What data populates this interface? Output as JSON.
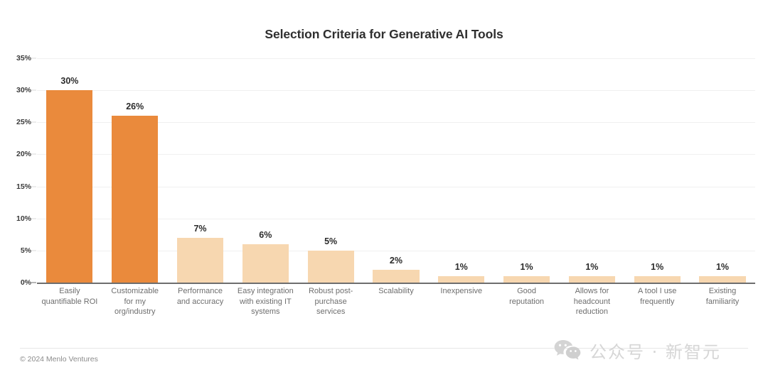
{
  "chart_data": {
    "type": "bar",
    "title": "Selection Criteria for Generative AI Tools",
    "xlabel": "",
    "ylabel": "",
    "ylim": [
      0,
      35
    ],
    "grid": true,
    "legend": "none",
    "y_ticks": [
      "0%",
      "5%",
      "10%",
      "15%",
      "20%",
      "25%",
      "30%",
      "35%"
    ],
    "y_tick_values": [
      0,
      5,
      10,
      15,
      20,
      25,
      30,
      35
    ],
    "categories": [
      "Easily\nquantifiable ROI",
      "Customizable\nfor my\norg/industry",
      "Performance\nand accuracy",
      "Easy integration\nwith existing IT\nsystems",
      "Robust post-\npurchase\nservices",
      "Scalability",
      "Inexpensive",
      "Good\nreputation",
      "Allows for\nheadcount\nreduction",
      "A tool I use\nfrequently",
      "Existing\nfamiliarity"
    ],
    "values": [
      30,
      26,
      7,
      6,
      5,
      2,
      1,
      1,
      1,
      1,
      1
    ],
    "data_labels": [
      "30%",
      "26%",
      "7%",
      "6%",
      "5%",
      "2%",
      "1%",
      "1%",
      "1%",
      "1%",
      "1%"
    ],
    "bar_colors": [
      "#ea8a3c",
      "#ea8a3c",
      "#f7d7b0",
      "#f7d7b0",
      "#f7d7b0",
      "#f7d7b0",
      "#f7d7b0",
      "#f7d7b0",
      "#f7d7b0",
      "#f7d7b0",
      "#f7d7b0"
    ],
    "accent_color": "#ea8a3c",
    "secondary_color": "#f7d7b0",
    "gridline_color": "#f0f0f0",
    "axis_color": "#6e6e6e"
  },
  "footer": {
    "credit": "© 2024 Menlo Ventures"
  },
  "watermark": {
    "icon": "wechat-icon",
    "text": "公众号 · 新智元"
  }
}
